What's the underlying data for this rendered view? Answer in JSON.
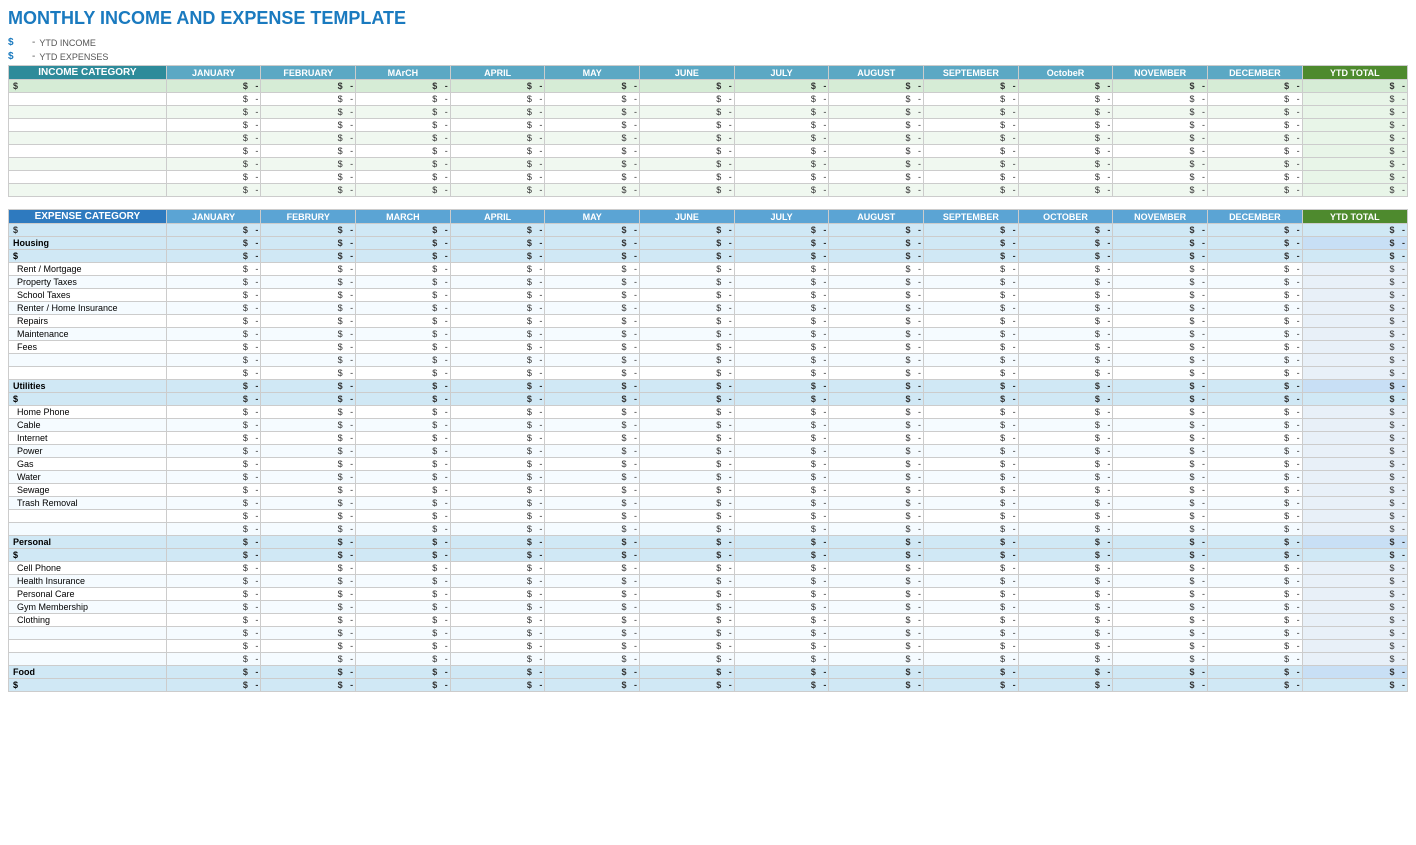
{
  "title": "MONTHLY INCOME AND EXPENSE TEMPLATE",
  "ytd": {
    "income_label": "YTD INCOME",
    "expense_label": "YTD EXPENSES",
    "dollar": "$",
    "dash": "-"
  },
  "months": [
    "JANUARY",
    "FEBRUARY",
    "MARCH",
    "APRIL",
    "MAY",
    "JUNE",
    "JULY",
    "AUGUST",
    "SEPTEMBER",
    "OCTOBER",
    "NOVEMBER",
    "DECEMBER"
  ],
  "months_expense": [
    "JANUARY",
    "FEBRURY",
    "MARCH",
    "APRIL",
    "MAY",
    "JUNE",
    "JULY",
    "AUGUST",
    "SEPTEMBER",
    "OCTOBER",
    "NOVEMBER",
    "DECEMBER"
  ],
  "ytd_total_label": "YTD TOTAL",
  "income_category_label": "INCOME CATEGORY",
  "expense_category_label": "EXPENSE CATEGORY",
  "income_rows": 8,
  "expense_sections": [
    {
      "name": "Housing",
      "items": [
        "Rent / Mortgage",
        "Property Taxes",
        "School Taxes",
        "Renter / Home Insurance",
        "Repairs",
        "Maintenance",
        "Fees",
        "",
        ""
      ]
    },
    {
      "name": "Utilities",
      "items": [
        "Home Phone",
        "Cable",
        "Internet",
        "Power",
        "Gas",
        "Water",
        "Sewage",
        "Trash Removal",
        "",
        ""
      ]
    },
    {
      "name": "Personal",
      "items": [
        "Cell Phone",
        "Health Insurance",
        "Personal Care",
        "Gym Membership",
        "Clothing",
        "",
        "",
        ""
      ]
    },
    {
      "name": "Food",
      "items": []
    }
  ],
  "dollar_sign": "$",
  "dash_val": "-"
}
